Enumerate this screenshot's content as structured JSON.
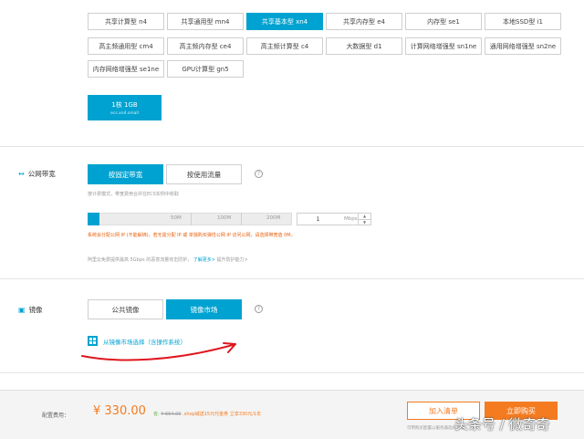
{
  "instance_types": [
    {
      "label": "共享计算型 n4",
      "active": false
    },
    {
      "label": "共享通用型 mn4",
      "active": false
    },
    {
      "label": "共享基本型 xn4",
      "active": true
    },
    {
      "label": "共享内存型 e4",
      "active": false
    },
    {
      "label": "内存型 se1",
      "active": false
    },
    {
      "label": "本地SSD型 i1",
      "active": false
    },
    {
      "label": "高主频通用型 cm4",
      "active": false
    },
    {
      "label": "高主频内存型 ce4",
      "active": false
    },
    {
      "label": "高主频计算型 c4",
      "active": false
    },
    {
      "label": "大数据型 d1",
      "active": false
    },
    {
      "label": "计算网络增强型 sn1ne",
      "active": false
    },
    {
      "label": "通用网络增强型 sn2ne",
      "active": false
    },
    {
      "label": "内存网络增强型 se1ne",
      "active": false
    },
    {
      "label": "GPU计算型 gn5",
      "active": false
    }
  ],
  "spec_card": {
    "main": "1核 1GB",
    "sub": "ecs.xn4.small"
  },
  "bandwidth": {
    "label": "公网带宽",
    "options": [
      {
        "label": "按固定带宽",
        "active": true
      },
      {
        "label": "按使用流量",
        "active": false
      }
    ],
    "help": "?",
    "billing_note": "按计费模式，带宽费用合并在ECS实例中收取",
    "slider_ticks": [
      "50M",
      "100M",
      "200M"
    ],
    "slider_level_fraction": 0.06,
    "value": "1",
    "unit": "Mbps",
    "warning": "系统会分配公网 IP (不能解绑)，若无需分配 IP 或 单独购买弹性公网 IP 访问公网，请选择带宽值 0M。",
    "ddos_note": "阿里云免费提供最高 5Gbps 的恶意流量攻击防护，",
    "ddos_link": "了解更多>",
    "ddos_link2": "提升防护能力>"
  },
  "image": {
    "label": "镜像",
    "options": [
      {
        "label": "公共镜像",
        "active": false
      },
      {
        "label": "镜像市场",
        "active": true
      }
    ],
    "help": "?",
    "market_link": "从镜像市场选择（含操作系统）"
  },
  "footer": {
    "cost_label": "配置费用：",
    "price": "¥ 330.00",
    "discount_prefix": "省: ",
    "original_price": "¥ 654.00",
    "promo": "   .shop域送15元代金券",
    "promo2": "  立享330元/1年",
    "add_list": "加入清单",
    "buy": "立即购买",
    "note": "可用购买配置以服务器选择为准"
  },
  "watermark": "头条号 / 微奇奇",
  "colors": {
    "accent": "#00a2d1",
    "orange": "#f47b20",
    "annotation": "#e0161f"
  }
}
